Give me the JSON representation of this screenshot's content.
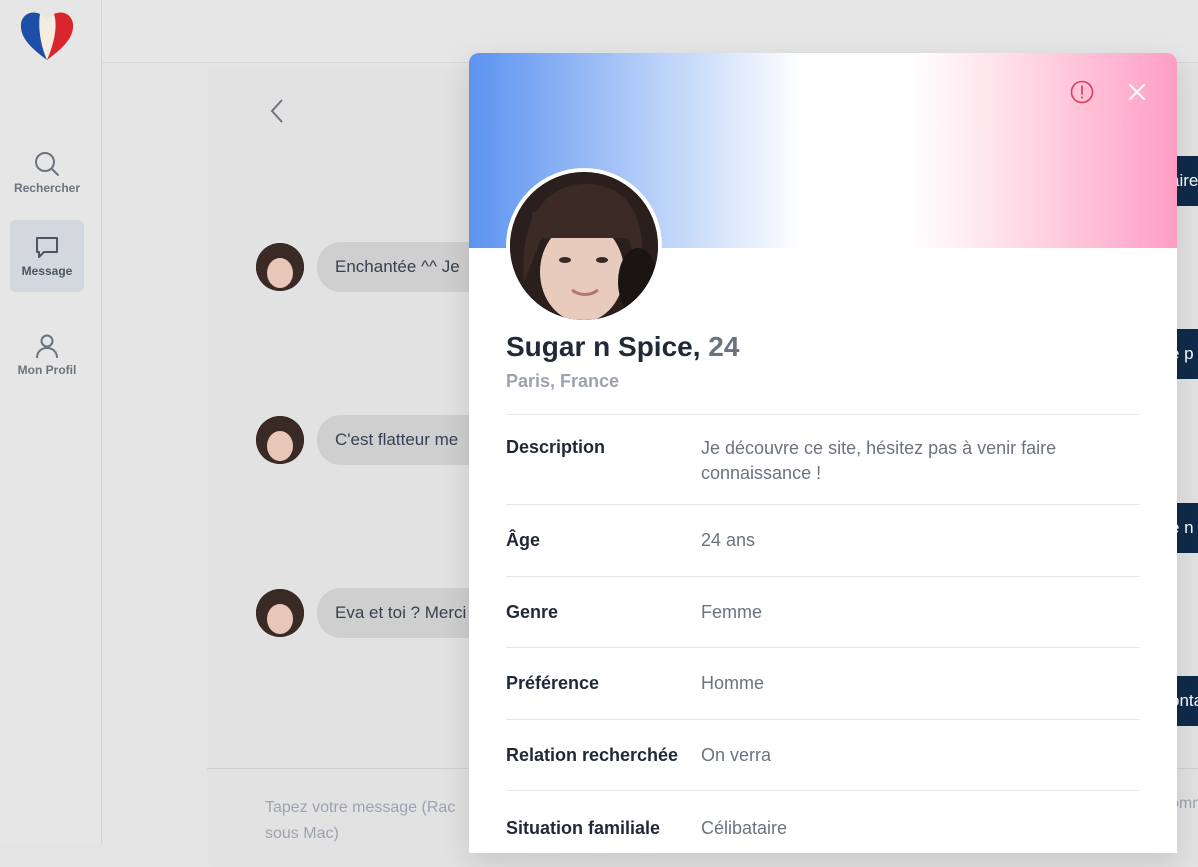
{
  "sidebar": {
    "items": [
      {
        "label": "Rechercher",
        "icon": "search-icon"
      },
      {
        "label": "Message",
        "icon": "message-icon"
      },
      {
        "label": "Mon Profil",
        "icon": "user-icon"
      }
    ],
    "active": "Message"
  },
  "chat": {
    "messages": [
      {
        "text": "Enchantée ^^ Je"
      },
      {
        "text": "C'est flatteur me"
      },
      {
        "text": "Eva et toi ? Merci"
      }
    ],
    "input_placeholder": "Tapez votre message (Rac sous Mac)",
    "right_peeks": [
      "aire",
      "e p",
      "e n",
      "onta"
    ],
    "right_peek_bottom": "omn"
  },
  "profile": {
    "name": "Sugar n Spice,",
    "age": "24",
    "location": "Paris, France",
    "details": [
      {
        "label": "Description",
        "value": "Je découvre ce site, hésitez pas à venir faire connaissance !"
      },
      {
        "label": "Âge",
        "value": "24 ans"
      },
      {
        "label": "Genre",
        "value": "Femme"
      },
      {
        "label": "Préférence",
        "value": "Homme"
      },
      {
        "label": "Relation recherchée",
        "value": "On verra"
      },
      {
        "label": "Situation familiale",
        "value": "Célibataire"
      }
    ]
  },
  "colors": {
    "banner_blue": "#5b93f0",
    "banner_pink": "#ff9ec4",
    "report_red": "#e0395b",
    "dark_navy": "#0f2a4a"
  }
}
